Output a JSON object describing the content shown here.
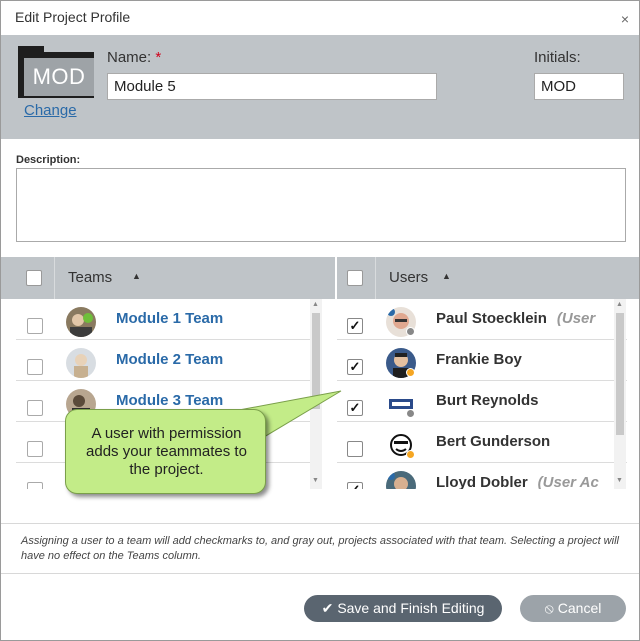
{
  "dialog": {
    "title": "Edit Project Profile",
    "close_glyph": "×"
  },
  "profile": {
    "icon_text": "MOD",
    "change_link": "Change",
    "name_label": "Name:",
    "required_mark": "*",
    "name_value": "Module 5",
    "initials_label": "Initials:",
    "initials_value": "MOD"
  },
  "description": {
    "label": "Description:",
    "value": ""
  },
  "teams": {
    "header": "Teams",
    "sort_glyph": "▲",
    "items": [
      {
        "name": "Module 1 Team",
        "checked": false
      },
      {
        "name": "Module 2 Team",
        "checked": false
      },
      {
        "name": "Module 3 Team",
        "checked": false
      },
      {
        "name": "",
        "checked": false
      },
      {
        "name": "",
        "checked": false
      }
    ]
  },
  "users": {
    "header": "Users",
    "sort_glyph": "▲",
    "items": [
      {
        "name": "Paul Stoecklein",
        "role": "(User",
        "checked": true,
        "status_color": "#888888"
      },
      {
        "name": "Frankie Boy",
        "role": "",
        "checked": true,
        "status_color": "#f5a623"
      },
      {
        "name": "Burt Reynolds",
        "role": "",
        "checked": true,
        "status_color": "#888888"
      },
      {
        "name": "Bert Gunderson",
        "role": "",
        "checked": false,
        "status_color": "#f5a623"
      },
      {
        "name": "Lloyd Dobler",
        "role": "(User Ac",
        "checked": true,
        "status_color": "#888888"
      }
    ]
  },
  "callout": {
    "text": "A user with permission adds your teammates to the project."
  },
  "note": {
    "text": "Assigning a user to a team will add checkmarks to, and gray out, projects associated with that team. Selecting a project will have no effect on the Teams column."
  },
  "buttons": {
    "save_label": "Save and Finish Editing",
    "save_glyph": "✔",
    "cancel_label": "Cancel",
    "cancel_glyph": "⦸"
  },
  "check_glyph": "✓",
  "colors": {
    "header_gray": "#bfc4c8",
    "link_blue": "#2a6aa8",
    "callout_green": "#c3ec88",
    "required_red": "#d0021b"
  }
}
